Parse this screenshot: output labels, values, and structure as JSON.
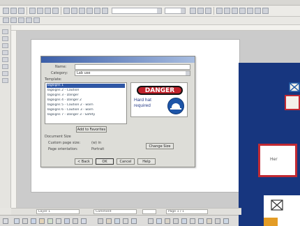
{
  "toolbar": {
    "font_combo_value": "",
    "size_combo_value": "",
    "colors": {
      "button_face": "#d0d3da"
    }
  },
  "dialog": {
    "title": "",
    "name_label": "Name:",
    "category_label": "Category:",
    "category_value": "Lab use",
    "list_label": "Template:",
    "list_items": [
      "Tagsigns 1",
      "Tagsigns 2 - Caution",
      "Tagsigns 3 - Danger",
      "Tagsigns 4 - Danger 2",
      "Tagsigns 5 - Caution 2 - warn",
      "Tagsigns 6 - Caution 3 - warn",
      "Tagsigns 7 - Danger 3 - Safety"
    ],
    "selected_index": 0,
    "add_button": "Add to Favorites",
    "section_label": "Document Size",
    "width_label": "Custom page size:",
    "width_value": "(w) in",
    "height_label": "Page orientation:",
    "height_value": "Portrait",
    "change_button": "Change Size",
    "buttons": [
      "< Back",
      "OK",
      "Cancel",
      "Help"
    ]
  },
  "preview": {
    "danger_text": "DANGER",
    "sign_text_line1": "Hard hat",
    "sign_text_line2": "required",
    "colors": {
      "danger_red": "#c0222b",
      "sign_blue": "#1d55a8"
    }
  },
  "overlay": {
    "card_text": "Her"
  },
  "status": {
    "field1": "Layer 1",
    "field2": "Comment",
    "field3": "",
    "field4": "Page 1 / 1"
  }
}
